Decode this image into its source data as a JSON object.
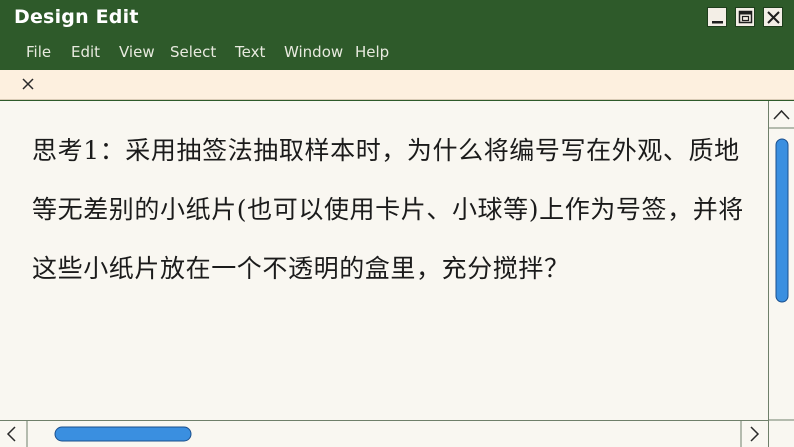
{
  "window": {
    "title": "Design Edit",
    "colors": {
      "frame": "#2e5a2a",
      "tab_bar": "#fdf0df",
      "content_bg": "#f9f7f1",
      "scroll_thumb": "#3a8fe0",
      "text": "#1b1b1b"
    }
  },
  "menu": {
    "items": [
      {
        "label": "File"
      },
      {
        "label": "Edit"
      },
      {
        "label": "View"
      },
      {
        "label": "Select"
      },
      {
        "label": "Text"
      },
      {
        "label": "Window"
      },
      {
        "label": "Help"
      }
    ]
  },
  "document": {
    "text": "思考1：采用抽签法抽取样本时，为什么将编号写在外观、质地等无差别的小纸片(也可以使用卡片、小球等)上作为号签，并将这些小纸片放在一个不透明的盒里，充分搅拌？"
  },
  "icons": {
    "minimize": "minimize-icon",
    "maximize": "restore-icon",
    "close": "close-icon",
    "tab_close": "close-icon",
    "scroll_up": "chevron-up-icon",
    "scroll_left": "chevron-left-icon",
    "scroll_right": "chevron-right-icon"
  }
}
